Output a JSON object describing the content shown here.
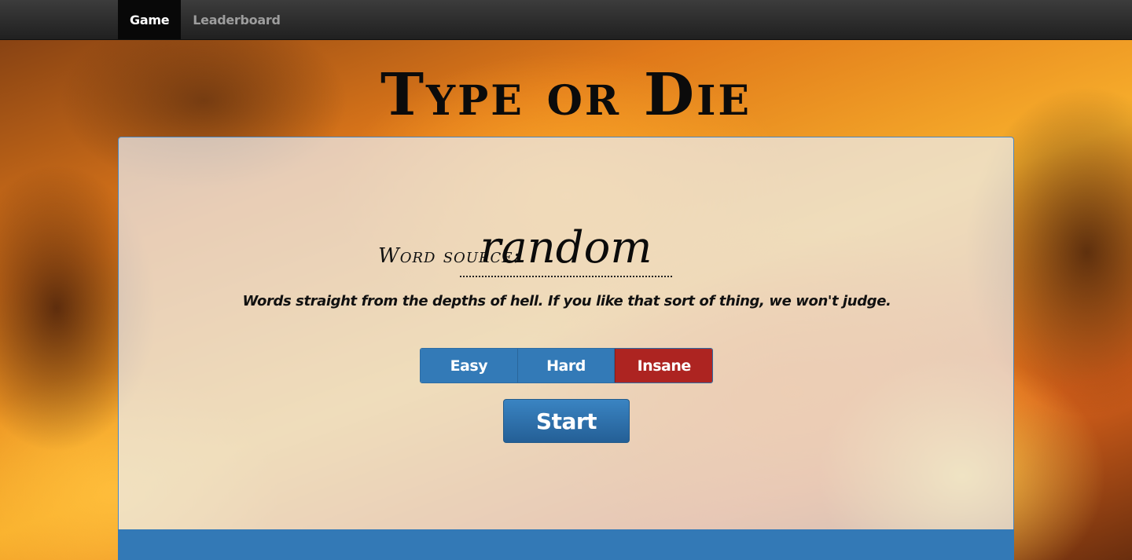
{
  "nav": {
    "tabs": [
      {
        "label": "Game",
        "active": true
      },
      {
        "label": "Leaderboard",
        "active": false
      }
    ]
  },
  "title": "Type or Die",
  "word_source": {
    "label": "Word source:",
    "value": "random",
    "description": "Words straight from the depths of hell.  If you like that sort of thing, we won't judge."
  },
  "difficulty": {
    "options": [
      "Easy",
      "Hard",
      "Insane"
    ],
    "selected": "Insane"
  },
  "start_label": "Start",
  "colors": {
    "primary": "#337ab7",
    "danger": "#ad2421",
    "navbar": "#222222"
  }
}
